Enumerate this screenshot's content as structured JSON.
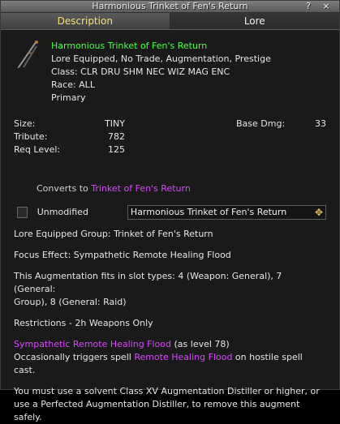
{
  "window": {
    "title": "Harmonious Trinket of Fen's Return",
    "buttons": [
      "?",
      "×"
    ]
  },
  "tabs": [
    {
      "label": "Description",
      "active": true
    },
    {
      "label": "Lore",
      "active": false
    }
  ],
  "item": {
    "name": "Harmonious Trinket of Fen's Return",
    "flags": "Lore Equipped, No Trade, Augmentation, Prestige",
    "class_line": "Class: CLR DRU SHM NEC WIZ MAG ENC",
    "race_line": "Race: ALL",
    "slot_line": "Primary"
  },
  "stats": {
    "size_label": "Size:",
    "size_value": "TINY",
    "tribute_label": "Tribute:",
    "tribute_value": "782",
    "req_label": "Req Level:",
    "req_value": "125",
    "base_dmg_label": "Base Dmg:",
    "base_dmg_value": "33"
  },
  "converts": {
    "prefix": "Converts to",
    "target": "Trinket of Fen's Return"
  },
  "augment": {
    "checkbox_label": "Unmodified",
    "selected": "Harmonious Trinket of Fen's Return"
  },
  "details": {
    "lore_group": "Lore Equipped Group: Trinket of Fen's Return",
    "focus": "Focus Effect: Sympathetic Remote Healing Flood",
    "slots_1": "This Augmentation fits in slot types: 4 (Weapon: General), 7 (General:",
    "slots_2": "Group), 8 (General: Raid)",
    "restrictions": "Restrictions - 2h Weapons Only",
    "spell_name": "Sympathetic Remote Healing Flood",
    "spell_level": "(as level 78)",
    "trigger_prefix": "Occasionally triggers spell",
    "trigger_spell": "Remote Healing Flood",
    "trigger_suffix": "on hostile spell cast.",
    "removal_1": "You must use a solvent Class XV Augmentation Distiller or higher, or",
    "removal_2": "use a Perfected Augmentation Distiller, to remove this augment safely."
  },
  "colors": {
    "name": "#47ff47",
    "link": "#d946ff",
    "tab_active": "#f4e081"
  }
}
